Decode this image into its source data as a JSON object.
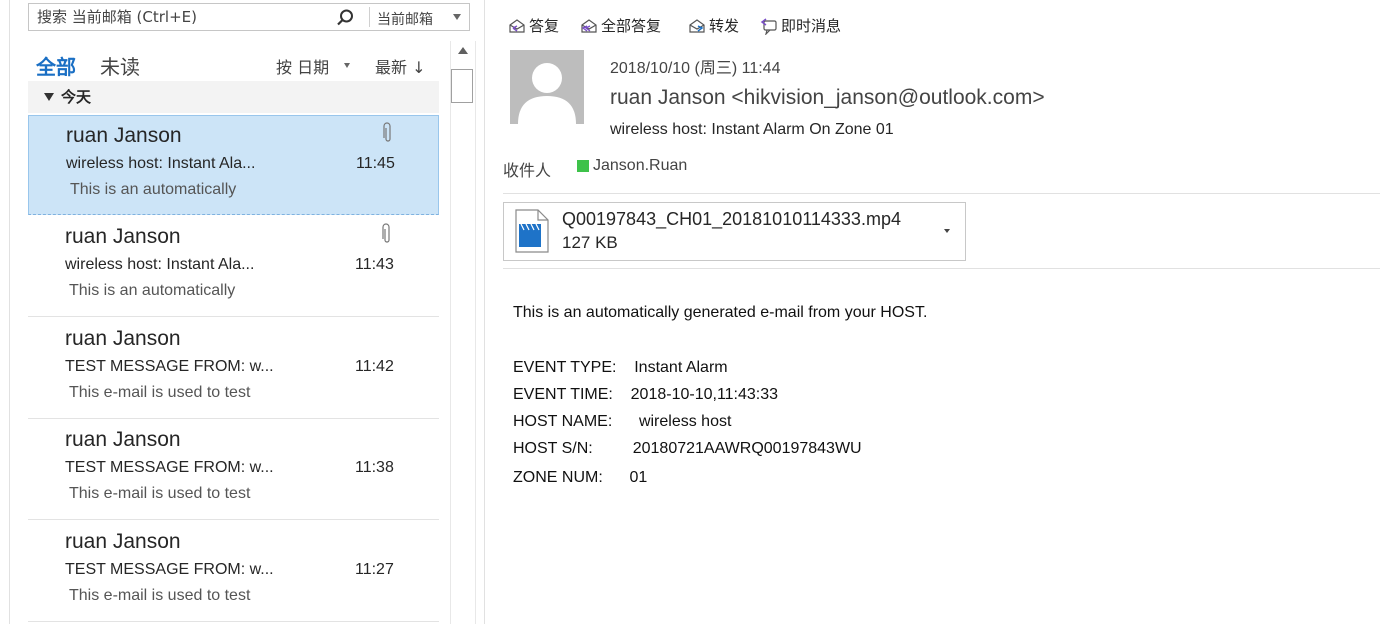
{
  "search": {
    "placeholder": "搜索 当前邮箱 (Ctrl+E)",
    "scope": "当前邮箱"
  },
  "filters": {
    "all": "全部",
    "unread": "未读",
    "sort_by": "按 日期",
    "sort_order": "最新 ↓"
  },
  "group": {
    "label": "今天"
  },
  "messages": [
    {
      "sender": "ruan Janson",
      "subject": "wireless host: Instant Ala...",
      "time": "11:45",
      "preview": "This is an automatically",
      "attachment": true,
      "selected": true
    },
    {
      "sender": "ruan Janson",
      "subject": "wireless host: Instant Ala...",
      "time": "11:43",
      "preview": "This is an automatically",
      "attachment": true,
      "selected": false
    },
    {
      "sender": "ruan Janson",
      "subject": "TEST MESSAGE FROM: w...",
      "time": "11:42",
      "preview": "This e-mail is used to test",
      "attachment": false,
      "selected": false
    },
    {
      "sender": "ruan Janson",
      "subject": "TEST MESSAGE FROM: w...",
      "time": "11:38",
      "preview": "This e-mail is used to test",
      "attachment": false,
      "selected": false
    },
    {
      "sender": "ruan Janson",
      "subject": "TEST MESSAGE FROM: w...",
      "time": "11:27",
      "preview": "This e-mail is used to test",
      "attachment": false,
      "selected": false
    }
  ],
  "actions": {
    "reply": "答复",
    "reply_all": "全部答复",
    "forward": "转发",
    "im": "即时消息"
  },
  "mail": {
    "date": "2018/10/10 (周三) 11:44",
    "from": "ruan Janson <hikvision_janson@outlook.com>",
    "subject": "wireless host: Instant Alarm On Zone 01",
    "to_label": "收件人",
    "to_name": "Janson.Ruan",
    "attachment": {
      "name": "Q00197843_CH01_20181010114333.mp4",
      "size": "127 KB"
    },
    "body": {
      "intro": "This is an automatically generated e-mail from your HOST.",
      "lines": [
        "EVENT TYPE:    Instant Alarm",
        "EVENT TIME:    2018-10-10,11:43:33",
        "HOST NAME:      wireless host",
        "HOST S/N:         20180721AAWRQ00197843WU",
        "ZONE NUM:      01"
      ]
    }
  },
  "colors": {
    "accent": "#1a6fc4",
    "selected_bg": "#cce4f7",
    "presence": "#3ec24a"
  }
}
